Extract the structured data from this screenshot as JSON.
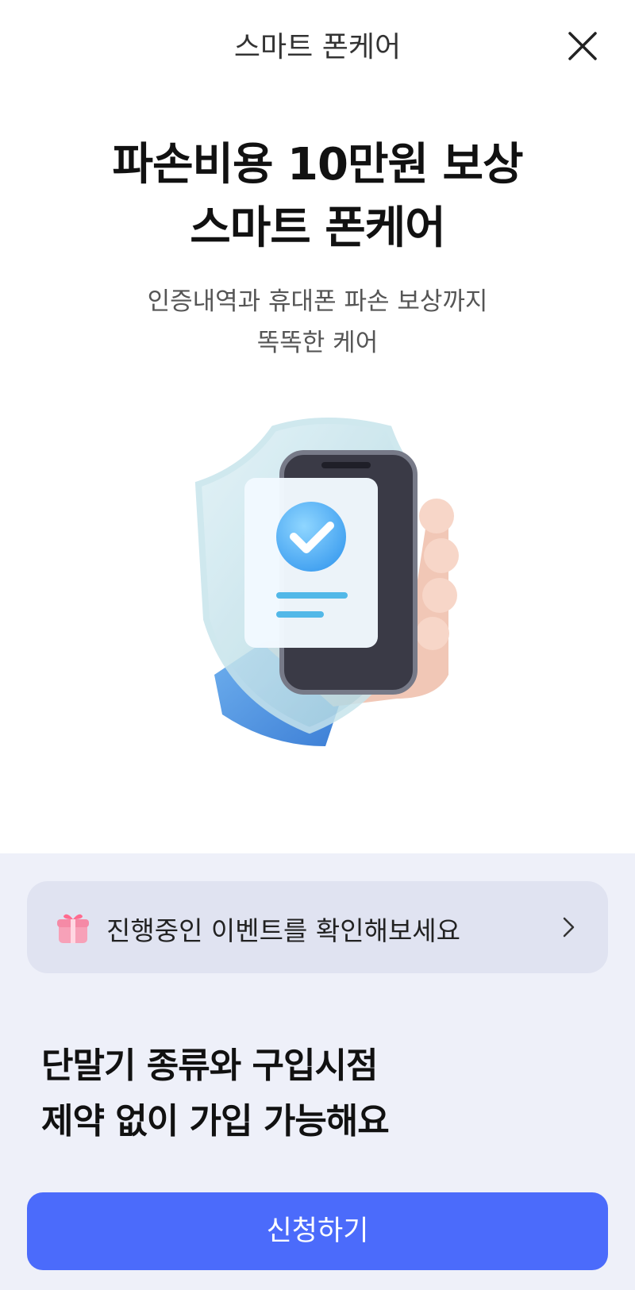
{
  "header": {
    "title": "스마트 폰케어",
    "close_icon": "close-icon"
  },
  "hero": {
    "title_line1": "파손비용 10만원 보상",
    "title_line2": "스마트 폰케어",
    "subtitle_line1": "인증내역과 휴대폰 파손 보상까지",
    "subtitle_line2": "똑똑한 케어",
    "illustration_icon": "shield-phone-check-illustration"
  },
  "event": {
    "icon": "gift-icon",
    "label": "진행중인 이벤트를 확인해보세요",
    "chevron": "chevron-right-icon"
  },
  "feature": {
    "title_line1": "단말기 종류와 구입시점",
    "title_line2": "제약 없이 가입 가능해요"
  },
  "cta": {
    "label": "신청하기"
  },
  "colors": {
    "accent": "#4b6bfb",
    "bottom_bg": "#eef0f9",
    "banner_bg": "#e0e3f1"
  }
}
